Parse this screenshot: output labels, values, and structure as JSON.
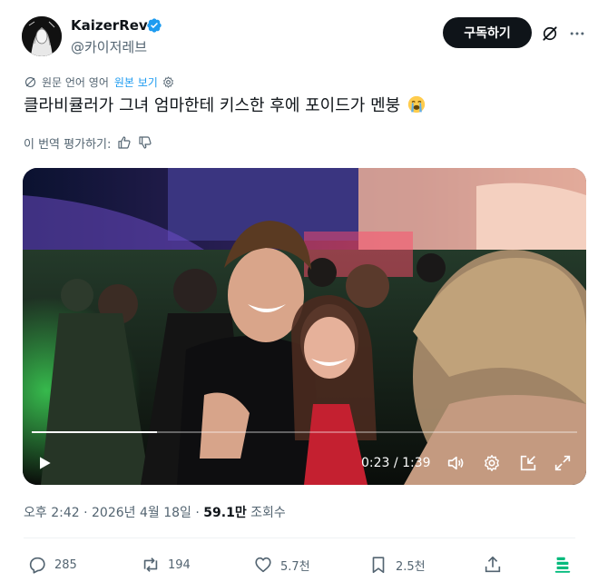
{
  "author": {
    "display_name": "KaizerRev",
    "handle": "@카이저레브",
    "verified": true
  },
  "header": {
    "subscribe_label": "구독하기"
  },
  "translation": {
    "source_label": "원문 언어 영어",
    "show_original_label": "원본 보기"
  },
  "tweet": {
    "text": "클라비큘러가 그녀 엄마한테 키스한 후에 포이드가 멘붕",
    "emoji": "loudly-crying-face-icon"
  },
  "rate_translation": {
    "label": "이 번역 평가하기:"
  },
  "video": {
    "current_time": "0:23",
    "separator": " / ",
    "duration": "1:39",
    "progress_fraction": 0.23
  },
  "meta": {
    "time": "오후 2:42",
    "dot1": " · ",
    "date": "2026년 4월 18일",
    "dot2": " · ",
    "views_count": "59.1만",
    "views_label": " 조회수"
  },
  "actions": {
    "replies": "285",
    "reposts": "194",
    "likes": "5.7천",
    "bookmarks": "2.5천"
  },
  "colors": {
    "accent": "#1d9bf0",
    "text_primary": "#0f1419",
    "text_secondary": "#536471",
    "button_dark": "#0f1419"
  }
}
